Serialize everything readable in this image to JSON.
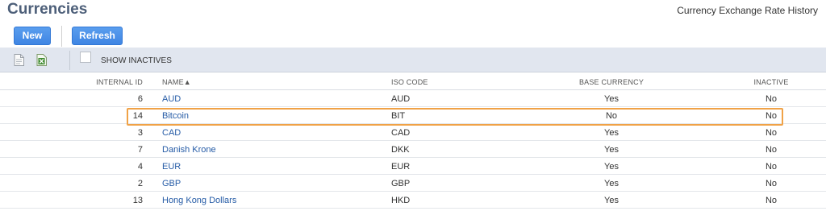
{
  "header": {
    "title": "Currencies",
    "history_link": "Currency Exchange Rate History"
  },
  "buttons": {
    "new_label": "New",
    "refresh_label": "Refresh"
  },
  "toolbar": {
    "show_inactives_label": "SHOW INACTIVES",
    "show_inactives_checked": false
  },
  "table": {
    "columns": {
      "internal_id": "INTERNAL ID",
      "name": "NAME▲",
      "iso_code": "ISO CODE",
      "base_currency": "BASE CURRENCY",
      "inactive": "INACTIVE"
    },
    "rows": [
      {
        "id": "6",
        "name": "AUD",
        "iso": "AUD",
        "base": "Yes",
        "inactive": "No"
      },
      {
        "id": "14",
        "name": "Bitcoin",
        "iso": "BIT",
        "base": "No",
        "inactive": "No"
      },
      {
        "id": "3",
        "name": "CAD",
        "iso": "CAD",
        "base": "Yes",
        "inactive": "No"
      },
      {
        "id": "7",
        "name": "Danish Krone",
        "iso": "DKK",
        "base": "Yes",
        "inactive": "No"
      },
      {
        "id": "4",
        "name": "EUR",
        "iso": "EUR",
        "base": "Yes",
        "inactive": "No"
      },
      {
        "id": "2",
        "name": "GBP",
        "iso": "GBP",
        "base": "Yes",
        "inactive": "No"
      },
      {
        "id": "13",
        "name": "Hong Kong Dollars",
        "iso": "HKD",
        "base": "Yes",
        "inactive": "No"
      }
    ]
  },
  "colors": {
    "accent": "#3f85e3",
    "highlight": "#f0a247",
    "link": "#255ba6"
  }
}
